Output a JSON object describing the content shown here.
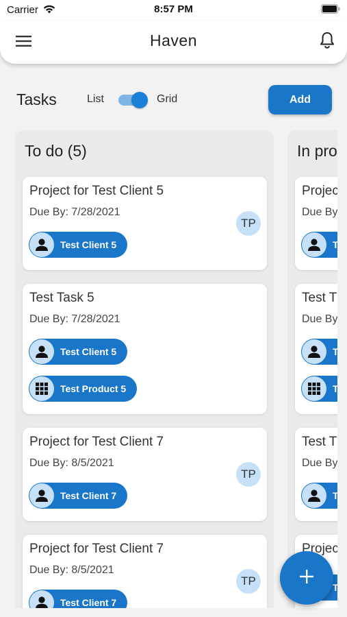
{
  "status_bar": {
    "carrier": "Carrier",
    "time": "8:57 PM"
  },
  "app_bar": {
    "title": "Haven"
  },
  "tasks_header": {
    "title": "Tasks",
    "view_list": "List",
    "view_grid": "Grid",
    "add_label": "Add"
  },
  "columns": [
    {
      "title": "To do (5)",
      "cards": [
        {
          "title": "Project for Test Client 5",
          "due": "Due By: 7/28/2021",
          "avatar": "TP",
          "client": "Test Client 5"
        },
        {
          "title": "Test Task 5",
          "due": "Due By: 7/28/2021",
          "client": "Test Client 5",
          "product": "Test Product 5"
        },
        {
          "title": "Project for Test Client 7",
          "due": "Due By: 8/5/2021",
          "avatar": "TP",
          "client": "Test Client 7"
        },
        {
          "title": "Project for Test Client 7",
          "due": "Due By: 8/5/2021",
          "avatar": "TP",
          "client": "Test Client 7"
        }
      ]
    },
    {
      "title": "In pro",
      "cards": [
        {
          "title": "Projec",
          "due": "Due By",
          "client": "Te"
        },
        {
          "title": "Test T",
          "due": "Due By",
          "client": "Te",
          "product": "Te"
        },
        {
          "title": "Test T",
          "due": "Due By",
          "client": "Te"
        },
        {
          "title": "Projec",
          "client": "Te"
        }
      ]
    }
  ],
  "colors": {
    "primary": "#1976c9",
    "chip_icon_bg": "#c6e0f7",
    "column_bg": "#eaeaea",
    "page_bg": "#f2f2f2"
  },
  "icons": {
    "menu": "menu-icon",
    "notifications": "bell-icon",
    "client": "person-icon",
    "product": "grid-icon",
    "fab": "plus-icon"
  }
}
